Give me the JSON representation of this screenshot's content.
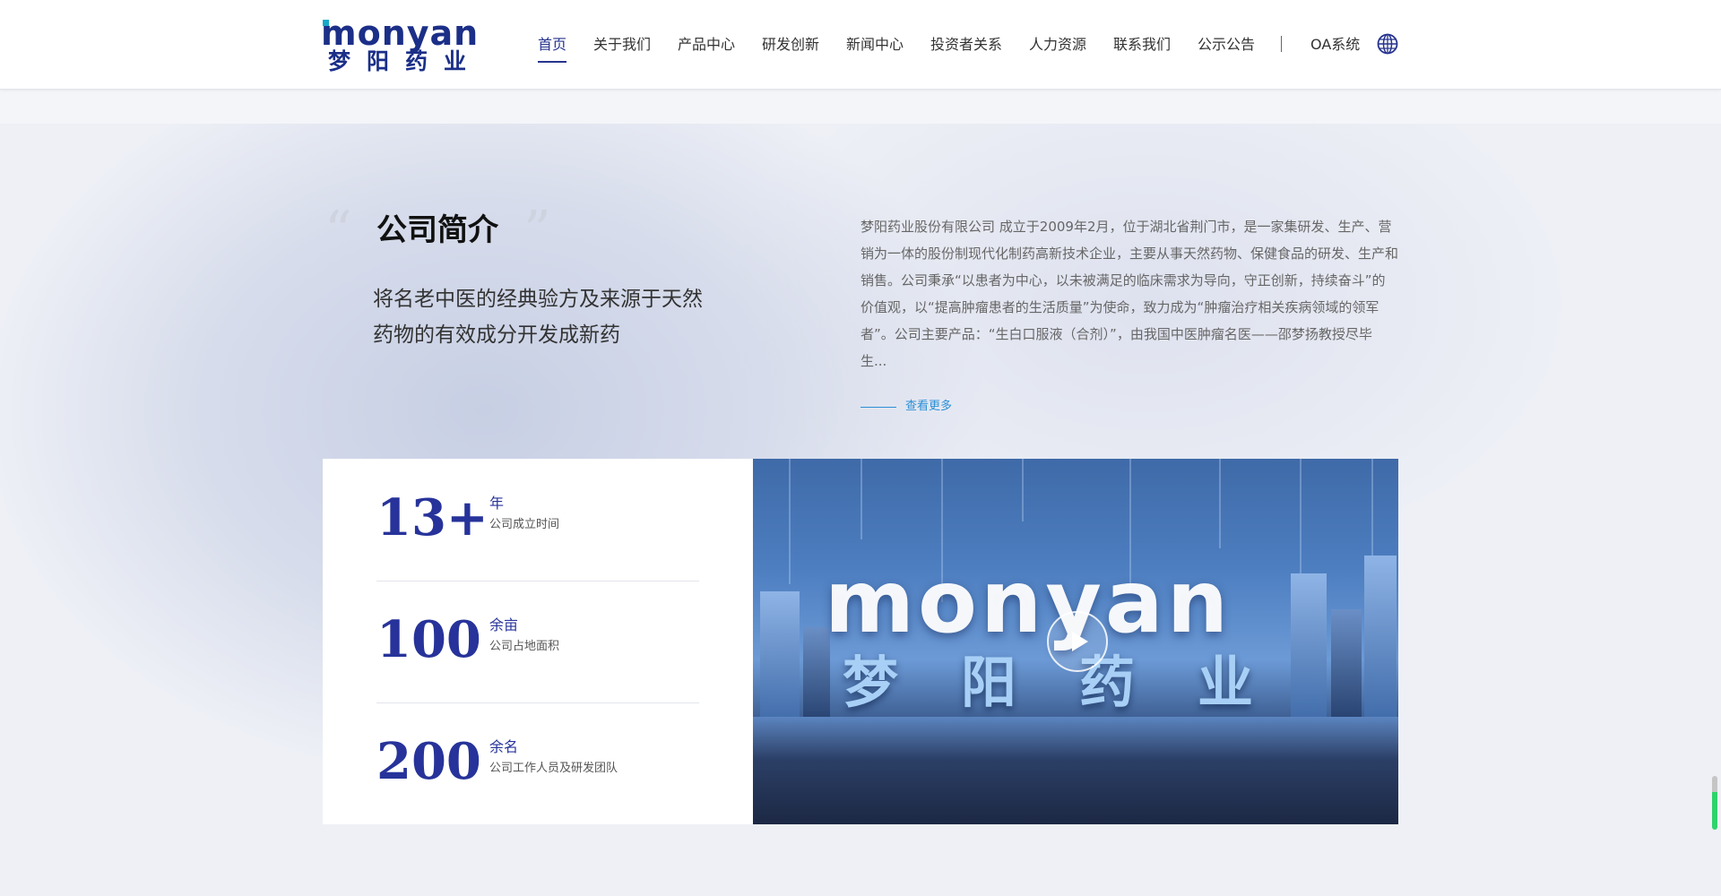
{
  "brand": {
    "logo_en": "monyan",
    "logo_cn": "梦阳药业"
  },
  "nav": {
    "items": [
      {
        "label": "首页",
        "active": true
      },
      {
        "label": "关于我们"
      },
      {
        "label": "产品中心"
      },
      {
        "label": "研发创新"
      },
      {
        "label": "新闻中心"
      },
      {
        "label": "投资者关系"
      },
      {
        "label": "人力资源"
      },
      {
        "label": "联系我们"
      },
      {
        "label": "公示公告"
      }
    ],
    "separator": "|",
    "oa_label": "OA系统",
    "language_icon": "globe-icon"
  },
  "intro": {
    "quote_open": "“",
    "quote_close": "”",
    "title": "公司简介",
    "slogan": "将名老中医的经典验方及来源于天然药物的有效成分开发成新药",
    "description": "梦阳药业股份有限公司 成立于2009年2月，位于湖北省荆门市，是一家集研发、生产、营销为一体的股份制现代化制药高新技术企业，主要从事天然药物、保健食品的研发、生产和销售。公司秉承“以患者为中心，以未被满足的临床需求为导向，守正创新，持续奋斗”的价值观，以“提高肿瘤患者的生活质量”为使命，致力成为“肿瘤治疗相关疾病领域的领军者”。公司主要产品：“生白口服液（合剂）”，由我国中医肿瘤名医——邵梦扬教授尽毕生...",
    "more_label": "查看更多"
  },
  "stats": [
    {
      "value": "13+",
      "unit": "年",
      "label": "公司成立时间"
    },
    {
      "value": "100",
      "unit": "余亩",
      "label": "公司占地面积"
    },
    {
      "value": "200",
      "unit": "余名",
      "label": "公司工作人员及研发团队"
    }
  ],
  "video": {
    "logo_en": "monyan",
    "logo_cn": "梦阳药业",
    "play_icon": "play-icon"
  },
  "colors": {
    "brand_blue": "#27348f",
    "stat_blue": "#27339a",
    "link_blue": "#2a8fd6"
  }
}
